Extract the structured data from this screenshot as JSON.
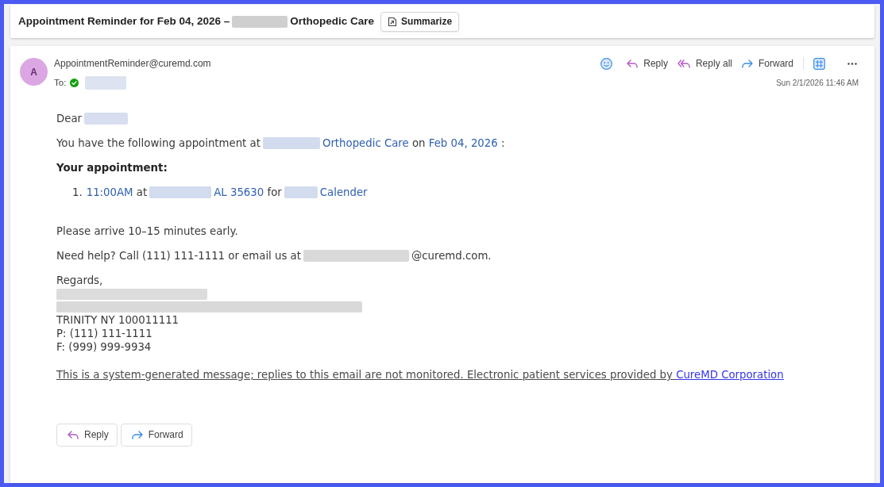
{
  "subject": {
    "parts": [
      {
        "kind": "text",
        "text": "Appointment Reminder for Feb 04, 2026 –"
      },
      {
        "kind": "redacted"
      },
      {
        "kind": "text",
        "text": "Orthopedic Care"
      }
    ],
    "summarize_button": "Summarize"
  },
  "message": {
    "avatar": "A",
    "sender": "AppointmentReminder@curemd.com",
    "to_label": "To:",
    "recipients": [
      {
        "kind": "redacted"
      }
    ],
    "actions": [
      {
        "kind": "reply",
        "label": "Reply"
      },
      {
        "kind": "reply_all",
        "label": "Reply all"
      },
      {
        "kind": "forward",
        "label": "Forward"
      }
    ],
    "date": "Sun 2/1/2026 11:46 AM"
  },
  "body": [
    {
      "kind": "paragraph",
      "parts": [
        {
          "kind": "text",
          "text": "Dear"
        },
        {
          "kind": "redacted"
        }
      ]
    },
    {
      "kind": "paragraph",
      "parts": [
        {
          "kind": "text",
          "text": "You have the following appointment at"
        },
        {
          "kind": "redacted"
        },
        {
          "kind": "value",
          "text": "Orthopedic Care"
        },
        {
          "kind": "text",
          "text": "on"
        },
        {
          "kind": "value",
          "text": "Feb 04, 2026"
        },
        {
          "kind": "text",
          "text": ":"
        }
      ]
    },
    {
      "kind": "heading",
      "text": "Your appointment:"
    },
    {
      "kind": "ordered_list",
      "items": [
        {
          "number": "1.",
          "parts": [
            {
              "kind": "value",
              "text": "11:00AM"
            },
            {
              "kind": "text",
              "text": "at"
            },
            {
              "kind": "redacted"
            },
            {
              "kind": "value",
              "text": "AL 35630"
            },
            {
              "kind": "text",
              "text": "for"
            },
            {
              "kind": "redacted"
            },
            {
              "kind": "value",
              "text": "Calender"
            }
          ]
        }
      ]
    },
    {
      "kind": "paragraph",
      "parts": [
        {
          "kind": "text",
          "text": "Please arrive 10–15 minutes early."
        }
      ]
    },
    {
      "kind": "paragraph",
      "parts": [
        {
          "kind": "text",
          "text": "Need help? Call (111) 111-1111 or email us at"
        },
        {
          "kind": "redacted"
        },
        {
          "kind": "text",
          "text": "@curemd.com."
        }
      ]
    },
    {
      "kind": "signature",
      "lines": [
        {
          "kind": "text",
          "text": "Regards,"
        },
        {
          "kind": "redacted"
        },
        {
          "kind": "redacted"
        },
        {
          "kind": "text",
          "text": "TRINITY NY 100011111"
        },
        {
          "kind": "text",
          "text": "P: (111) 111-1111"
        },
        {
          "kind": "text",
          "text": "F: (999) 999-9934"
        }
      ]
    },
    {
      "kind": "disclaimer",
      "text": "This is a system-generated message; replies to this email are not monitored. Electronic patient services provided by",
      "link": "CureMD Corporation"
    }
  ],
  "footer_actions": [
    {
      "kind": "reply",
      "label": "Reply"
    },
    {
      "kind": "forward",
      "label": "Forward"
    }
  ]
}
